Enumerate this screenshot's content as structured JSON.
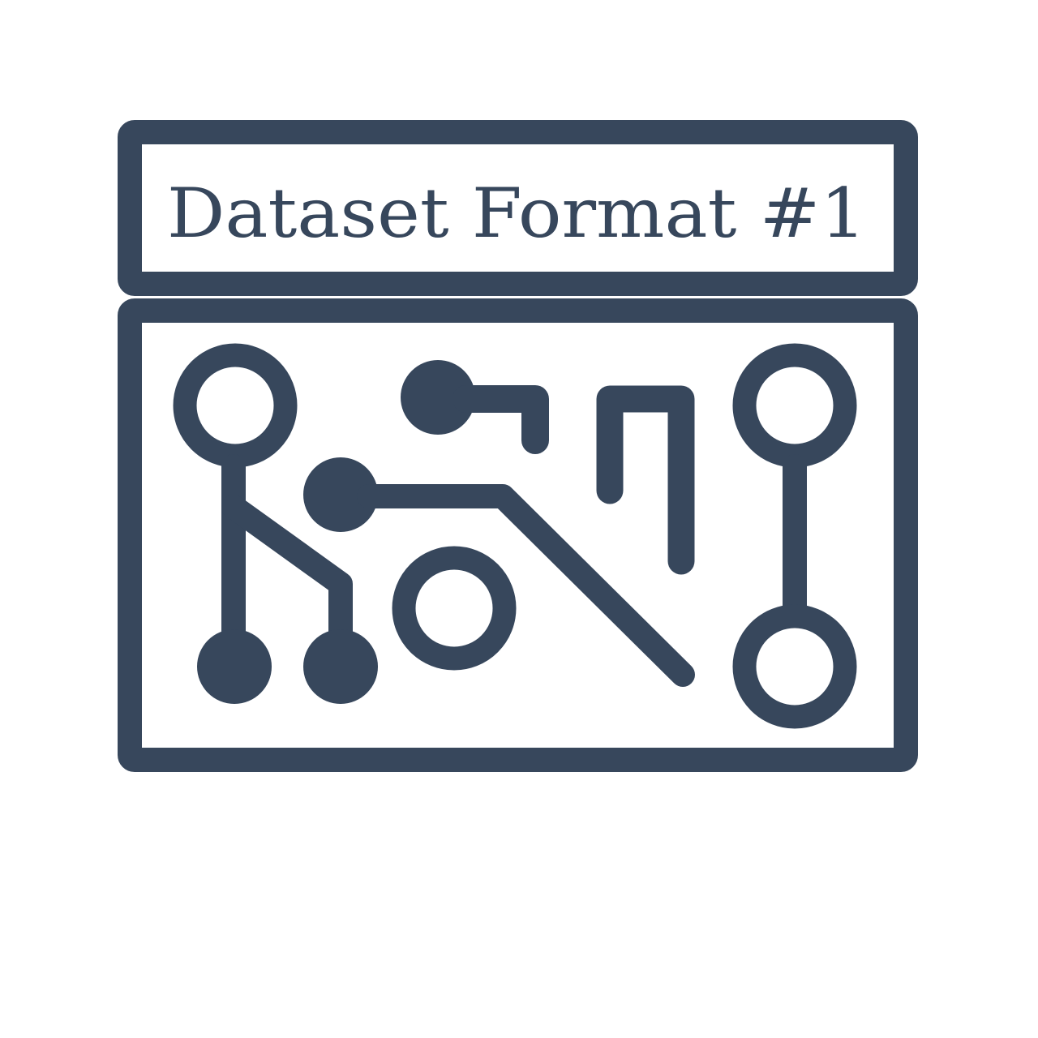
{
  "title": "Dataset Format #1",
  "colors": {
    "primary": "#37475c",
    "background": "#ffffff"
  },
  "icon": "circuit-board-icon"
}
